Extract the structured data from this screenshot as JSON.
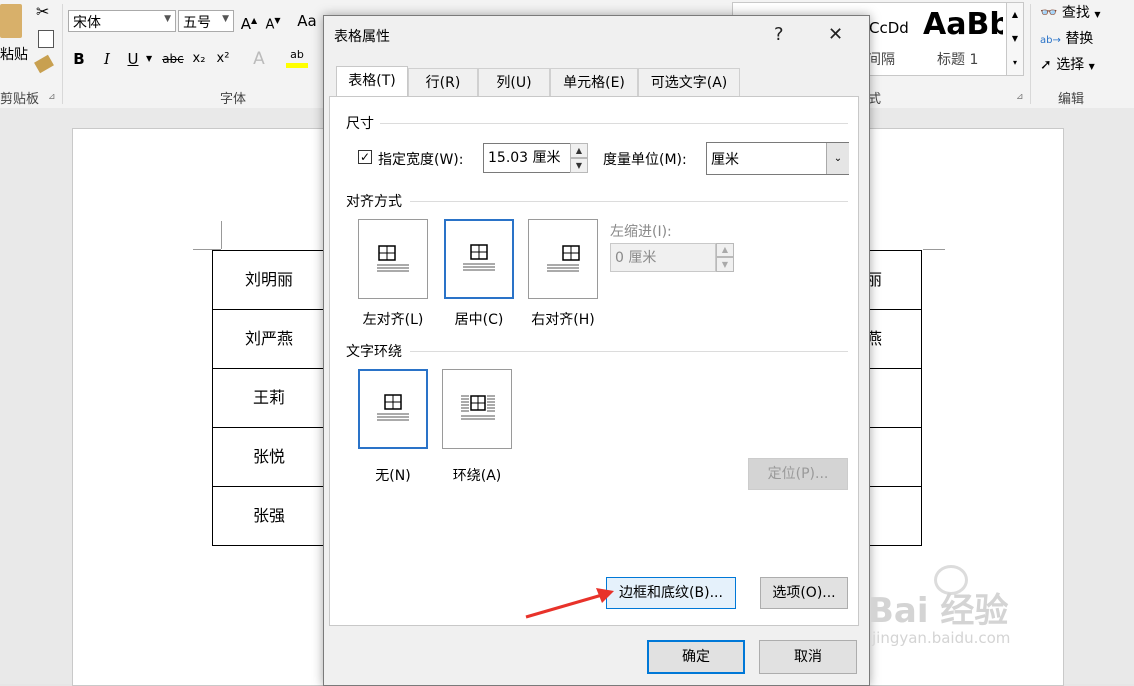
{
  "ribbon": {
    "clipboard": {
      "paste_label": "粘贴",
      "group_label": "剪贴板"
    },
    "font": {
      "font_name": "宋体",
      "font_size": "五号",
      "group_label": "字体",
      "aa_label": "Aa",
      "bold": "B",
      "italic": "I",
      "underline": "U",
      "strike": "abc",
      "subscript": "x₂",
      "superscript": "x²"
    },
    "styles": {
      "preview1_text": "CcDd",
      "preview1_label": "间隔",
      "preview2_text": "AaBb",
      "preview2_label": "标题 1",
      "group_label": "式"
    },
    "editing": {
      "find_label": "查找",
      "replace_label": "替换",
      "select_label": "选择",
      "group_label": "编辑"
    }
  },
  "document": {
    "left_column": [
      "刘明丽",
      "刘严燕",
      "王莉",
      "张悦",
      "张强"
    ],
    "right_column_visible": [
      "丽",
      "燕",
      "",
      "",
      ""
    ]
  },
  "dialog": {
    "title": "表格属性",
    "help_label": "?",
    "close_label": "✕",
    "tabs": [
      "表格(T)",
      "行(R)",
      "列(U)",
      "单元格(E)",
      "可选文字(A)"
    ],
    "active_tab": 0,
    "size": {
      "section_label": "尺寸",
      "width_checkbox_label": "指定宽度(W):",
      "width_checked": true,
      "width_value": "15.03 厘米",
      "unit_label": "度量单位(M):",
      "unit_value": "厘米"
    },
    "alignment": {
      "section_label": "对齐方式",
      "options": [
        "左对齐(L)",
        "居中(C)",
        "右对齐(H)"
      ],
      "selected": 1,
      "indent_label": "左缩进(I):",
      "indent_value": "0 厘米"
    },
    "wrapping": {
      "section_label": "文字环绕",
      "options": [
        "无(N)",
        "环绕(A)"
      ],
      "selected": 0,
      "position_button": "定位(P)..."
    },
    "borders_button": "边框和底纹(B)...",
    "options_button": "选项(O)...",
    "ok_button": "确定",
    "cancel_button": "取消"
  },
  "watermark": {
    "brand": "Bai 经验",
    "url": "jingyan.baidu.com"
  },
  "colors": {
    "accent": "#0078d7",
    "arrow": "#e8322a"
  }
}
